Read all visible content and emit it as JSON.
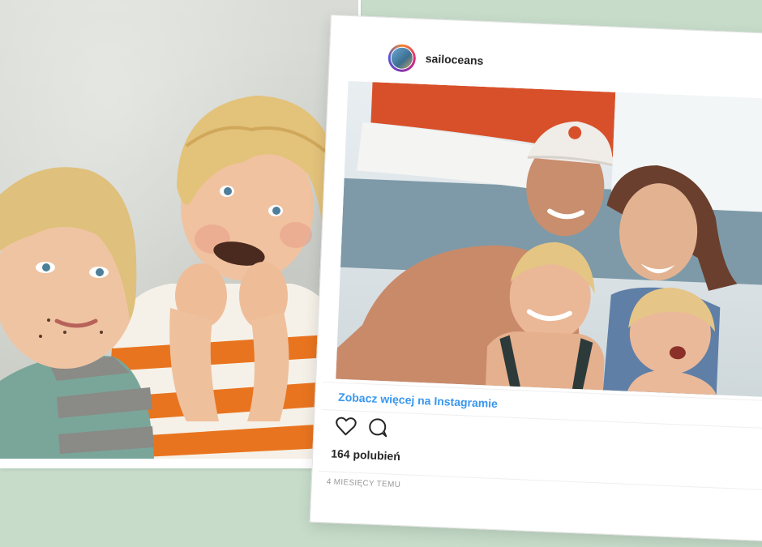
{
  "post": {
    "username": "sailoceans",
    "see_more": "Zobacz więcej na Instagramie",
    "likes": "164 polubień",
    "time": "4 MIESIĘCY TEMU"
  },
  "colors": {
    "background": "#c7ddca",
    "link": "#3897f0",
    "sail": "#d8502a"
  },
  "icons": [
    "heart-icon",
    "comment-icon"
  ]
}
